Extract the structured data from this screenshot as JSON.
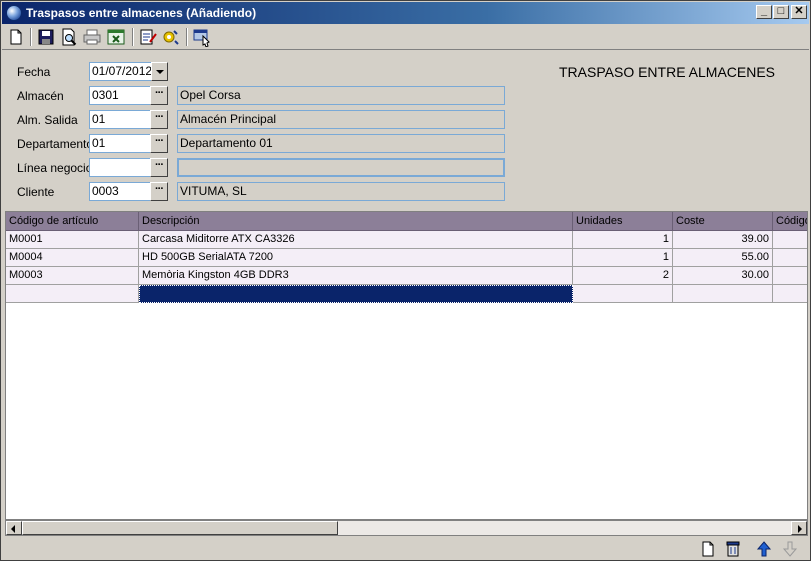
{
  "window": {
    "title": "Traspasos entre almacenes (Añadiendo)",
    "minimize_label": "_",
    "maximize_label": "□",
    "close_label": "✕"
  },
  "toolbar": {
    "icons": [
      "new-document-icon",
      "save-icon",
      "print-preview-icon",
      "print-icon",
      "export-excel-icon",
      "edit-notes-icon",
      "properties-icon",
      "exit-icon"
    ]
  },
  "form": {
    "heading": "TRASPASO ENTRE ALMACENES",
    "fecha": {
      "label": "Fecha",
      "value": "01/07/2012"
    },
    "almacen": {
      "label": "Almacén",
      "code": "0301",
      "name": "Opel Corsa"
    },
    "alm_salida": {
      "label": "Alm. Salida",
      "code": "01",
      "name": "Almacén Principal"
    },
    "departamento": {
      "label": "Departamento",
      "code": "01",
      "name": "Departamento 01"
    },
    "linea_negocio": {
      "label": "Línea negocio",
      "code": "",
      "name": ""
    },
    "cliente": {
      "label": "Cliente",
      "code": "0003",
      "name": "VITUMA, SL"
    },
    "lookup_button_label": "···"
  },
  "grid": {
    "columns": [
      "Código de artículo",
      "Descripción",
      "Unidades",
      "Coste",
      "Código"
    ],
    "rows": [
      {
        "codigo": "M0001",
        "descripcion": "Carcasa Miditorre ATX CA3326",
        "unidades": "1",
        "coste": "39.00"
      },
      {
        "codigo": "M0004",
        "descripcion": "HD 500GB SerialATA  7200",
        "unidades": "1",
        "coste": "55.00"
      },
      {
        "codigo": "M0003",
        "descripcion": "Memòria Kingston 4GB DDR3",
        "unidades": "2",
        "coste": "30.00"
      },
      {
        "codigo": "",
        "descripcion": "",
        "unidades": "",
        "coste": ""
      }
    ]
  },
  "bottom_toolbar": {
    "icons": [
      "new-line-icon",
      "delete-line-icon",
      "move-up-icon",
      "move-down-icon"
    ]
  },
  "colors": {
    "title_bar": "#0a246a",
    "grid_header": "#8c7f98",
    "row_background": "#f4eef7",
    "selected_cell": "#0a246a",
    "field_border": "#7aa9d6"
  }
}
